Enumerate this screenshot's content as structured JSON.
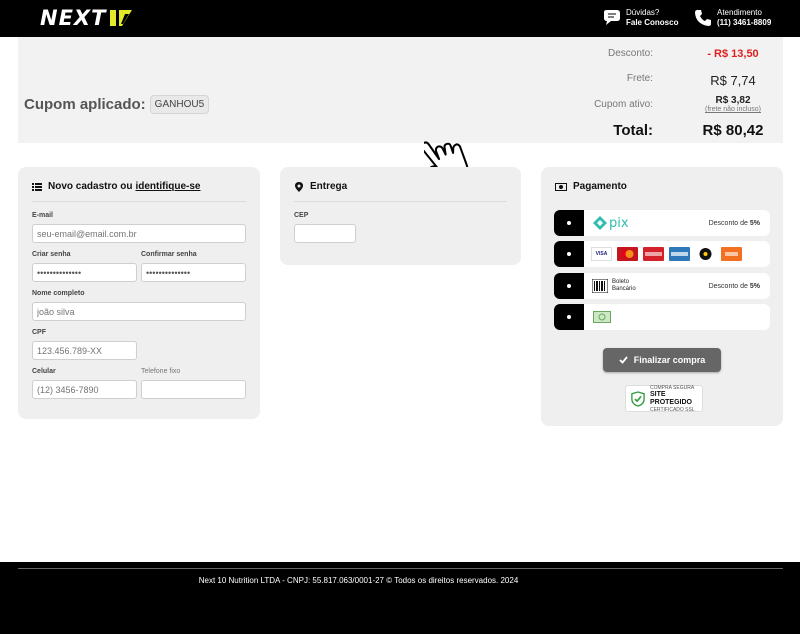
{
  "header": {
    "logo_text": "NEXT",
    "help_label": "Dúvidas?",
    "help_link": "Fale Conosco",
    "service_label": "Atendimento",
    "service_phone": "(11) 3461-8809"
  },
  "summary": {
    "coupon_label": "Cupom aplicado:",
    "coupon_code": "GANHOU5",
    "discount_label": "Desconto:",
    "discount_value": "- R$ 13,50",
    "shipping_label": "Frete:",
    "shipping_value": "R$ 7,74",
    "active_coupon_label": "Cupom ativo:",
    "active_coupon_value": "R$ 3,82",
    "active_coupon_note": "(frete não incluso)",
    "total_label": "Total:",
    "total_value": "R$ 80,42"
  },
  "register": {
    "title_prefix": "Novo cadastro ou",
    "title_link": "identifique-se",
    "email_label": "E-mail",
    "email_placeholder": "seu-email@email.com.br",
    "password_label": "Criar senha",
    "password_value": "••••••••••••••",
    "confirm_label": "Confirmar senha",
    "confirm_value": "••••••••••••••",
    "name_label": "Nome completo",
    "name_placeholder": "joão silva",
    "cpf_label": "CPF",
    "cpf_placeholder": "123.456.789-XX",
    "mobile_label": "Celular",
    "mobile_placeholder": "(12) 3456-7890",
    "phone_label": "Telefone fixo",
    "phone_placeholder": ""
  },
  "delivery": {
    "title": "Entrega",
    "cep_label": "CEP",
    "cep_value": ""
  },
  "payment": {
    "title": "Pagamento",
    "pix_text": "pix",
    "pix_discount_prefix": "Desconto de",
    "pix_discount": "5%",
    "boleto_text_1": "Boleto",
    "boleto_text_2": "Bancário",
    "boleto_discount_prefix": "Desconto de",
    "boleto_discount": "5%",
    "card_brands": [
      "VISA",
      "mastercard",
      "diners",
      "amex",
      "elo",
      "hipercard"
    ],
    "finalize_label": "Finalizar compra",
    "seal_top": "COMPRA SEGURA",
    "seal_main": "SITE PROTEGIDO",
    "seal_bottom": "CERTIFICADO SSL"
  },
  "footer": {
    "copyright": "Next 10 Nutrition LTDA - CNPJ: 55.817.063/0001-27 © Todos os direitos reservados. 2024"
  },
  "colors": {
    "header_bg": "#000000",
    "logo_accent": "#e3ea2a",
    "discount_red": "#e02020",
    "pix_teal": "#32bcad",
    "button_gray": "#666666",
    "seal_green": "#2e9b3b"
  }
}
